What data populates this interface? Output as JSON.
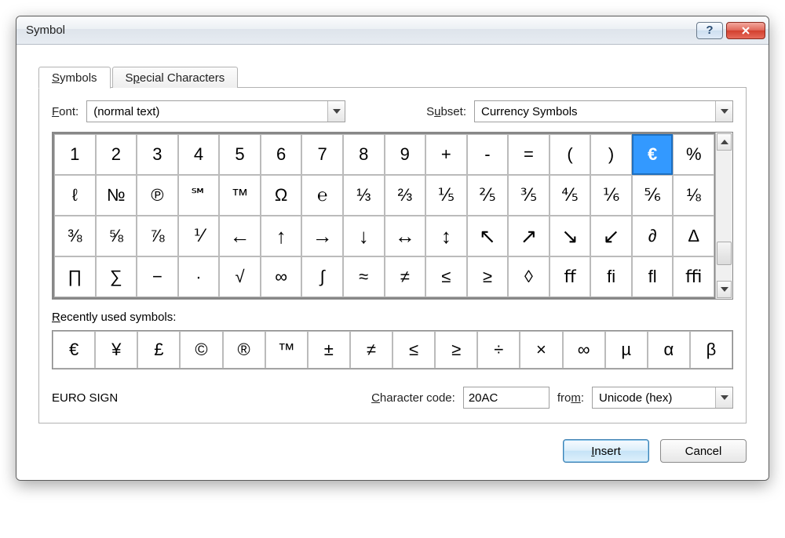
{
  "window": {
    "title": "Symbol"
  },
  "tabs": {
    "symbols_pre": "S",
    "symbols_rest": "ymbols",
    "special_pre": "S",
    "special_mn": "p",
    "special_rest": "ecial Characters"
  },
  "font": {
    "label_pre": "F",
    "label_rest": "ont:",
    "value": "(normal text)"
  },
  "subset": {
    "label_pre": "S",
    "label_mn": "u",
    "label_rest": "bset:",
    "value": "Currency Symbols"
  },
  "grid": {
    "rows": [
      [
        "1",
        "2",
        "3",
        "4",
        "5",
        "6",
        "7",
        "8",
        "9",
        "+",
        "-",
        "=",
        "(",
        ")",
        "€",
        "%"
      ],
      [
        "ℓ",
        "№",
        "℗",
        "℠",
        "™",
        "Ω",
        "℮",
        "⅓",
        "⅔",
        "⅕",
        "⅖",
        "⅗",
        "⅘",
        "⅙",
        "⅚",
        "⅛"
      ],
      [
        "⅜",
        "⅝",
        "⅞",
        "⅟",
        "←",
        "↑",
        "→",
        "↓",
        "↔",
        "↕",
        "↖",
        "↗",
        "↘",
        "↙",
        "∂",
        "∆"
      ],
      [
        "∏",
        "∑",
        "−",
        "∙",
        "√",
        "∞",
        "∫",
        "≈",
        "≠",
        "≤",
        "≥",
        "◊",
        "ﬀ",
        "ﬁ",
        "ﬂ",
        "ﬃ"
      ]
    ],
    "selected_index": 14
  },
  "recent": {
    "label_pre": "R",
    "label_rest": "ecently used symbols:",
    "items": [
      "€",
      "¥",
      "£",
      "©",
      "®",
      "™",
      "±",
      "≠",
      "≤",
      "≥",
      "÷",
      "×",
      "∞",
      "µ",
      "α",
      "β"
    ]
  },
  "character": {
    "name": "EURO SIGN",
    "code_label_pre": "C",
    "code_label_rest": "haracter code:",
    "code_value": "20AC",
    "from_label_pre": "fro",
    "from_label_mn": "m",
    "from_label_rest": ":",
    "from_value": "Unicode (hex)"
  },
  "buttons": {
    "insert_pre": "I",
    "insert_rest": "nsert",
    "cancel": "Cancel"
  }
}
